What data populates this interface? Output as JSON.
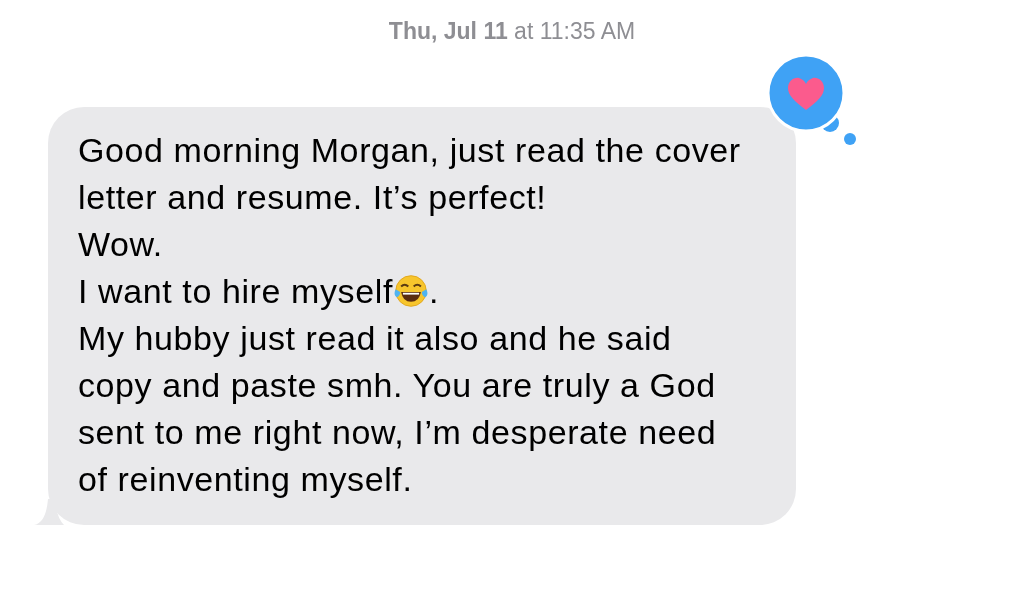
{
  "timestamp": "**Thu, Jul 11** at 11:35 AM",
  "message": {
    "reacted": true,
    "paragraphs": [
      {
        "text": "Good morning Morgan, just read the cover letter and resume. It’s perfect!",
        "emoji": false
      },
      {
        "text": "Wow.",
        "emoji": false
      },
      {
        "text": "I want to hire myself",
        "emoji": true,
        "after": "."
      },
      {
        "text": "My hubby just read it also and he said copy and paste smh. You are truly a God sent to me right now, I’m desperate need of reinventing myself.",
        "emoji": false
      }
    ]
  }
}
